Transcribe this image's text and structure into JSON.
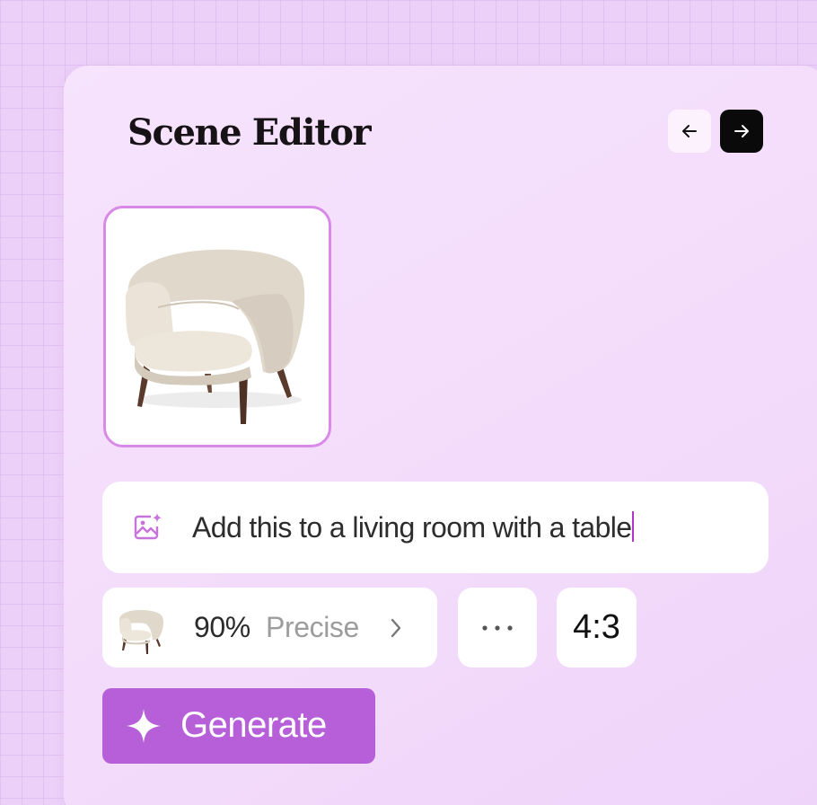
{
  "editor": {
    "title": "Scene Editor"
  },
  "navigation": {
    "prev_icon": "arrow-left-icon",
    "next_icon": "arrow-right-icon"
  },
  "reference_image": {
    "subject": "armchair"
  },
  "prompt": {
    "icon": "image-sparkle-icon",
    "value": "Add this to a living room with a table"
  },
  "precision": {
    "percent": "90%",
    "mode": "Precise"
  },
  "more_options": {
    "icon": "more-dots-icon"
  },
  "aspect_ratio": {
    "value": "4:3"
  },
  "generate": {
    "label": "Generate",
    "icon": "sparkle-icon"
  },
  "colors": {
    "accent": "#b65fd9",
    "thumbnail_border": "#d98ae8",
    "background": "#ecd0f8",
    "caret": "#b234c8"
  }
}
